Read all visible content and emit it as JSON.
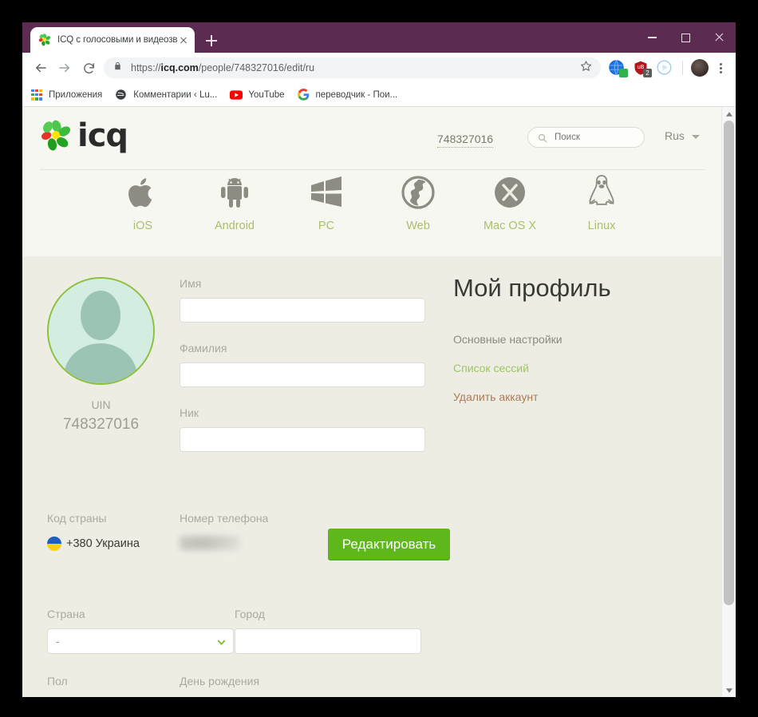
{
  "browser": {
    "tab": {
      "title": "ICQ с голосовыми и видеозвон",
      "favicon": "icq-flower-icon",
      "close_icon": "close-icon"
    },
    "new_tab_label": "+",
    "window_controls": {
      "minimize": "minimize-icon",
      "maximize": "maximize-icon",
      "close": "close-icon"
    },
    "nav": {
      "back": "back-arrow-icon",
      "forward": "forward-arrow-icon",
      "reload": "reload-icon"
    },
    "omnibox": {
      "lock_icon": "lock-icon",
      "scheme": "https://",
      "host": "icq.com",
      "path": "/people/748327016/edit/ru",
      "full_url": "https://icq.com/people/748327016/edit/ru",
      "star_icon": "star-icon"
    },
    "extensions": [
      {
        "name": "extension-globe-icon",
        "badge": "",
        "badge_color": "#2FB34A"
      },
      {
        "name": "extension-shield-icon",
        "badge": "2",
        "badge_color": "#5B5B5B"
      },
      {
        "name": "extension-play-icon",
        "badge": "",
        "badge_color": ""
      }
    ],
    "profile_avatar": "profile-avatar",
    "menu_icon": "three-dots-menu-icon",
    "bookmarks": [
      {
        "label": "Приложения",
        "icon": "apps-grid-icon"
      },
      {
        "label": "Комментарии ‹ Lu...",
        "icon": "globe-dark-icon"
      },
      {
        "label": "YouTube",
        "icon": "youtube-icon"
      },
      {
        "label": "переводчик - Пои...",
        "icon": "google-g-icon"
      }
    ]
  },
  "site": {
    "logo_text": "icq",
    "uin_link": "748327016",
    "search": {
      "placeholder": "Поиск",
      "icon": "search-icon",
      "value": ""
    },
    "language": {
      "label": "Rus",
      "caret": "chevron-down-icon"
    },
    "platforms": [
      {
        "label": "iOS",
        "icon": "apple-icon"
      },
      {
        "label": "Android",
        "icon": "android-icon"
      },
      {
        "label": "PC",
        "icon": "windows-icon"
      },
      {
        "label": "Web",
        "icon": "globe-icon"
      },
      {
        "label": "Mac OS X",
        "icon": "mac-x-icon"
      },
      {
        "label": "Linux",
        "icon": "linux-penguin-icon"
      }
    ],
    "profile": {
      "avatar_icon": "default-user-avatar",
      "uin_label": "UIN",
      "uin_value": "748327016"
    },
    "form": {
      "fields": [
        {
          "label": "Имя",
          "value": "",
          "name": "first-name"
        },
        {
          "label": "Фамилия",
          "value": "",
          "name": "last-name"
        },
        {
          "label": "Ник",
          "value": "",
          "name": "nickname"
        }
      ],
      "country_code_label": "Код страны",
      "country_code_value": "+380 Украина",
      "country_flag": "ukraine-flag-icon",
      "phone_label": "Номер телефона",
      "phone_value": "",
      "edit_button": "Редактировать",
      "country_label": "Страна",
      "country_select_value": "-",
      "city_label": "Город",
      "city_value": "",
      "gender_label": "Пол",
      "birthday_label": "День рождения"
    },
    "sidebar": {
      "title": "Мой профиль",
      "links": [
        {
          "label": "Основные настройки",
          "color": "#8A8A80"
        },
        {
          "label": "Список сессий",
          "color": "#9FC464"
        },
        {
          "label": "Удалить аккаунт",
          "color": "#B07A55"
        }
      ]
    },
    "colors": {
      "accent_green": "#5FB81B",
      "header_bg": "#F7F7F2",
      "main_bg": "#EDEDE4",
      "chrome_purple": "#5B2B51"
    }
  }
}
